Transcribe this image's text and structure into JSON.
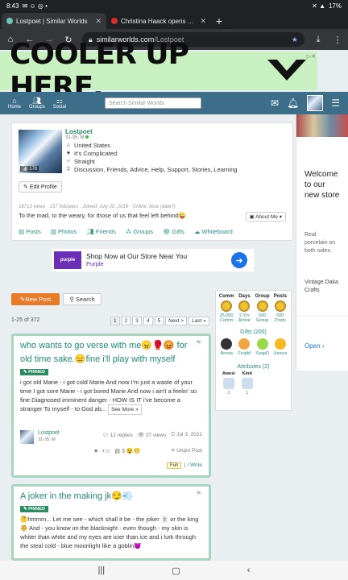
{
  "status": {
    "time": "8:43",
    "battery": "17%"
  },
  "tabs": [
    {
      "title": "Lostpoet | Similar Worlds"
    },
    {
      "title": "Christina Haack opens up ab"
    }
  ],
  "omnibox": {
    "host": "similarworlds.com",
    "path": "/Lostpoet"
  },
  "ad_top": {
    "headline": "COOLER UP HERE."
  },
  "site_header": {
    "nav": [
      {
        "label": "Home"
      },
      {
        "label": "Groups"
      },
      {
        "label": "Social"
      }
    ],
    "search_placeholder": "Search Similar Worlds"
  },
  "profile": {
    "name": "Lostpoet",
    "sub": "31-35, M",
    "photo_count": "176",
    "details": [
      {
        "icon": "house-icon",
        "text": "United States"
      },
      {
        "icon": "heart-icon",
        "text": "It's Complicated"
      },
      {
        "icon": "person-icon",
        "text": "Straight"
      },
      {
        "icon": "bulb-icon",
        "text": "Discussion, Friends, Advice, Help, Support, Stories, Learning"
      }
    ],
    "edit_label": "Edit Profile",
    "meta": "18713 views · 157 followers · Joined: July 20, 2018 · Online: Now (date?)",
    "bio": "To the mad, to the weary, for those of us that feel left behind😜",
    "about_label": "About Me",
    "tabs": [
      "Posts",
      "Photos",
      "Friends",
      "Groups",
      "Gifts",
      "Whiteboard"
    ]
  },
  "mid_ad": {
    "headline": "Shop Now at Our Store Near You",
    "brand": "Purple",
    "logo": "purple"
  },
  "side_ad": {
    "welcome": "Welcome to our new store",
    "desc": "Real porcelain on both sides.",
    "brand": "Vintage Daka Crafts",
    "open": "Open"
  },
  "controls": {
    "new_post": "New Post",
    "search": "Search",
    "count": "1-25 of 372",
    "pages": [
      "1",
      "2",
      "3",
      "4",
      "5",
      "Next >",
      "Last »"
    ]
  },
  "stats": {
    "cols": [
      {
        "head": "Comm",
        "value": "25,000 Comm"
      },
      {
        "head": "Days",
        "value": "2 Yrs Active"
      },
      {
        "head": "Group",
        "value": "500 Group"
      },
      {
        "head": "Posts",
        "value": "500 Posts"
      }
    ],
    "gifts_title": "Gifts (200)",
    "gifts": [
      "Bossa",
      "FrogM",
      "SoapD",
      "Jussca"
    ],
    "attr_title": "Attributes (2)",
    "attrs": [
      {
        "head": "Awesi",
        "n": "1"
      },
      {
        "head": "Kind",
        "n": "1"
      }
    ]
  },
  "posts": [
    {
      "title": "who wants to go verse with me😠🥊😡 for old time sake.😑fine i'll play with myself",
      "pinned": "PINNED",
      "body": "i got old Marie - i got cold Marie And now I'm just a waste of your time I got sore Marie - i got bored Marie And now i ain't a feelin' so fine Diagnosed imminent danger - HOW IS IT i've become a stranger To myself - to God ab...",
      "see_more": "See More »",
      "author": "Lostpoet",
      "author_sub": "31-35, M",
      "replies": "12 replies",
      "views": "37 views",
      "date": "Jul 3, 2021",
      "unpin": "Unpin Post",
      "reactions": "3",
      "tag": "Fun",
      "write": "I Write"
    },
    {
      "title": "A joker in the making jk😏💨",
      "pinned": "PINNED",
      "body": "🤔hmmm... Let me see - which shall it be - the joker 🃏 or the king 🤴 And - you know im the blacknight - even though - my skin is whiter than white and my eyes are icier than ice and i lurk through the steal cold - blue moonlight like a goblin👿"
    }
  ]
}
